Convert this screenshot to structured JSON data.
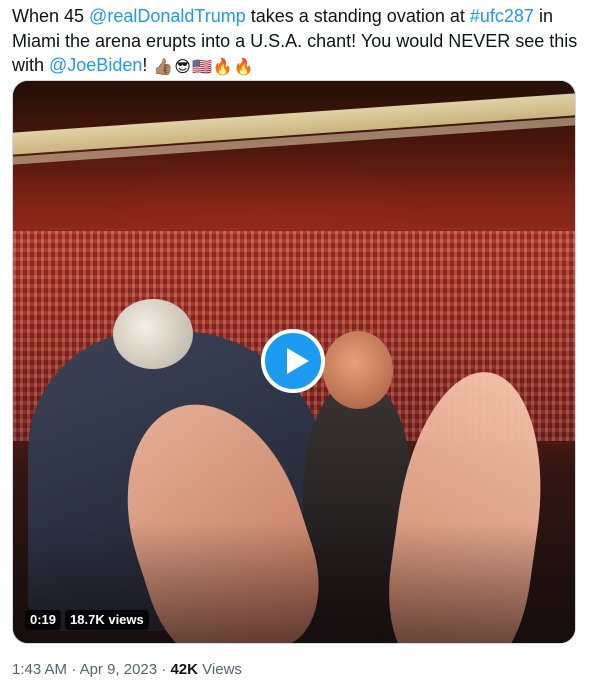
{
  "tweet": {
    "segments": [
      {
        "text": "When 45 ",
        "type": "text"
      },
      {
        "text": "@realDonaldTrump",
        "type": "mention"
      },
      {
        "text": " takes a standing ovation at ",
        "type": "text"
      },
      {
        "text": "#ufc287",
        "type": "hashtag"
      },
      {
        "text": " in Miami the arena erupts into a U.S.A. chant! You would NEVER see this with ",
        "type": "text"
      },
      {
        "text": "@JoeBiden",
        "type": "mention"
      },
      {
        "text": "! ",
        "type": "text"
      }
    ],
    "emojis": [
      "👍🏽",
      "😎",
      "🇺🇸",
      "🔥",
      "🔥"
    ]
  },
  "video": {
    "duration": "0:19",
    "views": "18.7K views",
    "play_icon": "play-icon"
  },
  "meta": {
    "time": "1:43 AM",
    "separator1": " · ",
    "date": "Apr 9, 2023",
    "separator2": " · ",
    "views_count": "42K",
    "views_label": " Views"
  },
  "colors": {
    "link": "#1d9bf0",
    "text": "#0f1419",
    "secondary": "#536471"
  }
}
